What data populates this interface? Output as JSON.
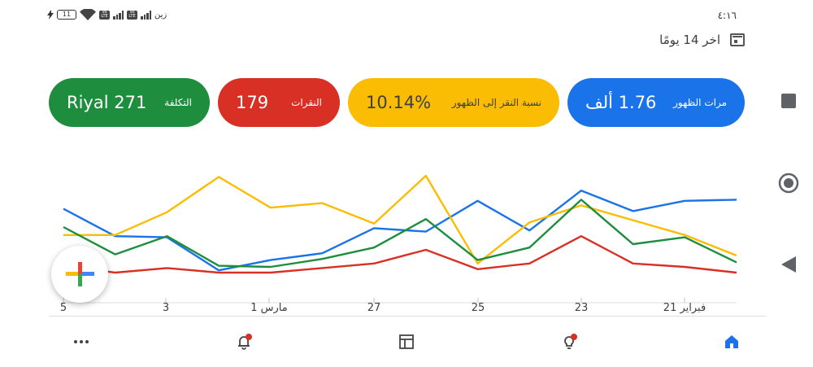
{
  "status_bar": {
    "time": "٤:١٦",
    "battery": "11",
    "carrier": "زين",
    "volte": "Vo LTE"
  },
  "date_range": {
    "label": "اخر 14 يومًا"
  },
  "metrics": {
    "impressions": {
      "label": "مرات الظهور",
      "value": "1.76 ألف",
      "color": "#1a73e8"
    },
    "ctr": {
      "label": "نسبة النقر إلى الظهور",
      "value": "10.14%",
      "color": "#fbbc04"
    },
    "clicks": {
      "label": "النقرات",
      "value": "179",
      "color": "#d93025"
    },
    "cost": {
      "label": "التكلفة",
      "value": "Riyal 271",
      "color": "#1e8e3e"
    }
  },
  "chart_data": {
    "type": "line",
    "x_tick_labels": [
      "5",
      "3",
      "1 مارس",
      "27",
      "25",
      "23",
      "21 فبراير"
    ],
    "series": [
      {
        "name": "مرات الظهور",
        "color": "#1a73e8",
        "values": [
          0.56,
          0.32,
          0.31,
          0.02,
          0.11,
          0.17,
          0.39,
          0.36,
          0.63,
          0.37,
          0.72,
          0.54,
          0.63,
          0.64
        ]
      },
      {
        "name": "نسبة النقر إلى الظهور",
        "color": "#fbbc04",
        "values": [
          0.33,
          0.33,
          0.53,
          0.84,
          0.57,
          0.61,
          0.43,
          0.85,
          0.08,
          0.44,
          0.59,
          0.46,
          0.33,
          0.15
        ]
      },
      {
        "name": "التكلفة",
        "color": "#1e8e3e",
        "values": [
          0.4,
          0.16,
          0.32,
          0.06,
          0.05,
          0.12,
          0.22,
          0.47,
          0.11,
          0.22,
          0.64,
          0.25,
          0.31,
          0.09
        ]
      },
      {
        "name": "النقرات",
        "color": "#d93025",
        "values": [
          0.06,
          0.0,
          0.04,
          0.0,
          0.0,
          0.04,
          0.08,
          0.2,
          0.03,
          0.08,
          0.32,
          0.08,
          0.05,
          0.0
        ]
      }
    ]
  },
  "icons": {
    "fab": "add-icon",
    "nav": [
      "more-icon",
      "notifications-icon",
      "dashboard-icon",
      "recommendations-icon",
      "home-icon"
    ],
    "system": [
      "recents-icon",
      "home-circle-icon",
      "back-icon"
    ]
  }
}
